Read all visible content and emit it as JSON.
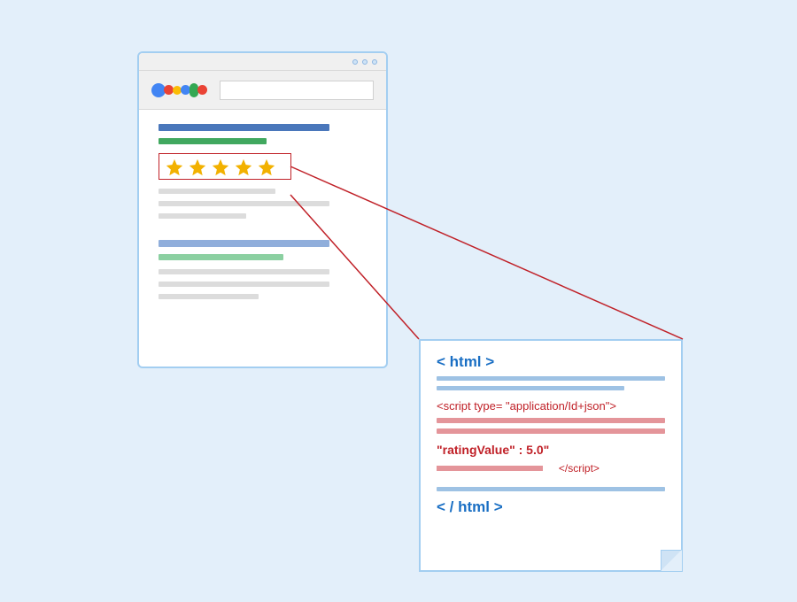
{
  "rating": {
    "star_count": 5,
    "icon_name": "star-icon"
  },
  "code": {
    "open_html": "< html >",
    "script_open": "<script type= \"application/Id+json\">",
    "rating_value": "\"ratingValue\" : 5.0\"",
    "script_close": "</script>",
    "close_html": "< / html >"
  }
}
